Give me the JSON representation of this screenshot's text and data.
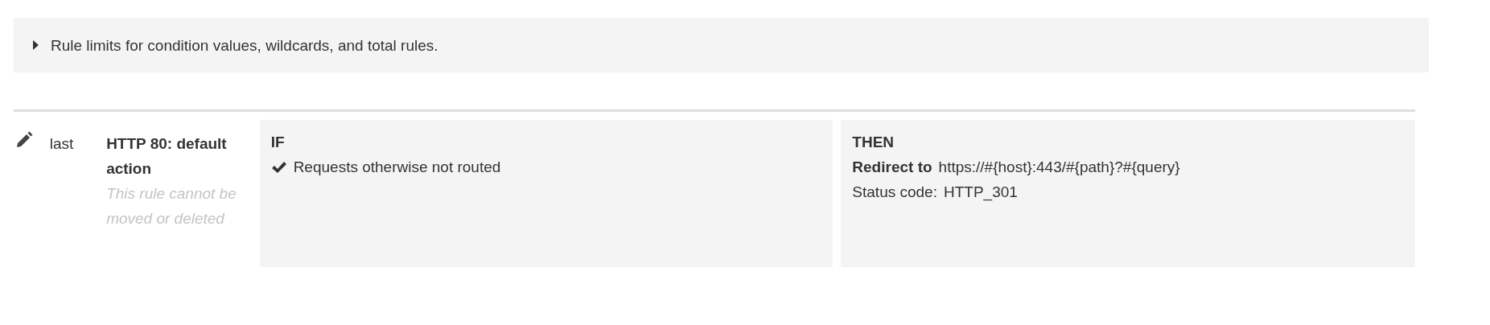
{
  "limits_panel": {
    "label": "Rule limits for condition values, wildcards, and total rules.",
    "expanded": false
  },
  "rule": {
    "priority": "last",
    "name": "HTTP 80: default action",
    "note": "This rule cannot be moved or deleted",
    "if": {
      "heading": "IF",
      "conditions": [
        {
          "text": "Requests otherwise not routed"
        }
      ]
    },
    "then": {
      "heading": "THEN",
      "action_label": "Redirect to",
      "action_value": "https://#{host}:443/#{path}?#{query}",
      "status_label": "Status code:",
      "status_value": "HTTP_301"
    }
  }
}
